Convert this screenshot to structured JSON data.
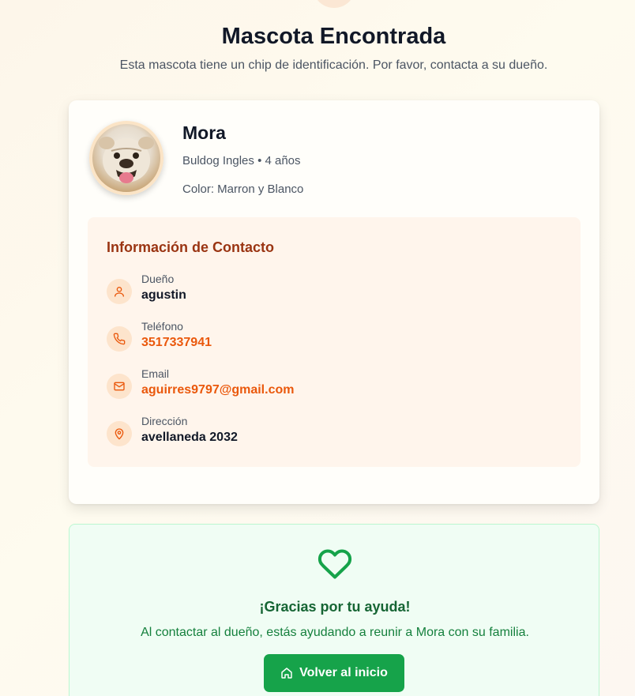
{
  "header": {
    "title": "Mascota Encontrada",
    "subtitle": "Esta mascota tiene un chip de identificación. Por favor, contacta a su dueño."
  },
  "pet": {
    "name": "Mora",
    "breed_age": "Buldog Ingles • 4 años",
    "color": "Color: Marron y Blanco"
  },
  "contact": {
    "title": "Información de Contacto",
    "owner_label": "Dueño",
    "owner_value": "agustin",
    "phone_label": "Teléfono",
    "phone_value": "3517337941",
    "email_label": "Email",
    "email_value": "aguirres9797@gmail.com",
    "address_label": "Dirección",
    "address_value": "avellaneda 2032"
  },
  "thanks": {
    "title": "¡Gracias por tu ayuda!",
    "text": "Al contactar al dueño, estás ayudando a reunir a Mora con su familia.",
    "button_label": "Volver al inicio"
  },
  "colors": {
    "accent": "#ea580c",
    "contact_title": "#9a3412",
    "success": "#16a34a",
    "success_text": "#166534"
  },
  "icons": [
    "user-icon",
    "phone-icon",
    "mail-icon",
    "map-pin-icon",
    "heart-icon",
    "home-icon"
  ]
}
